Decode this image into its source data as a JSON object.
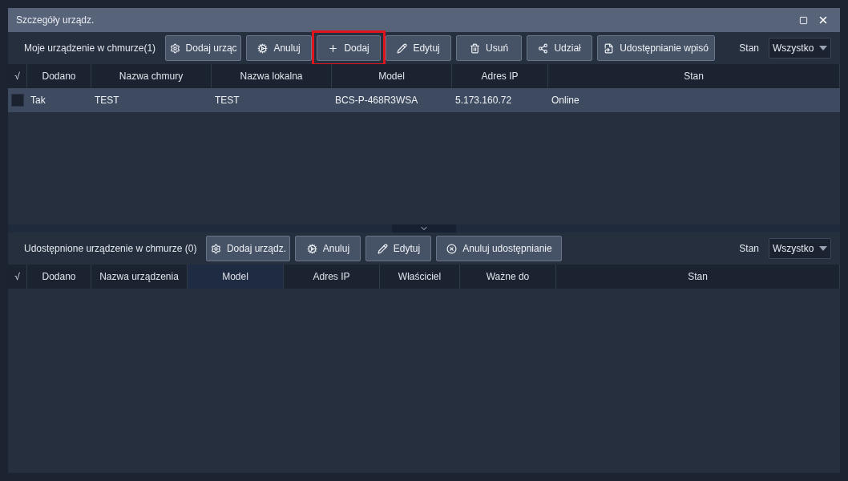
{
  "window": {
    "title": "Szczegóły urządz."
  },
  "my_devices": {
    "label": "Moje urządzenie w chmurze(1)",
    "buttons": [
      {
        "kind": "add-device",
        "label": "Dodaj urząc",
        "highlighted": false
      },
      {
        "kind": "cancel",
        "label": "Anuluj",
        "highlighted": false
      },
      {
        "kind": "add",
        "label": "Dodaj",
        "highlighted": true
      },
      {
        "kind": "edit",
        "label": "Edytuj",
        "highlighted": false
      },
      {
        "kind": "delete",
        "label": "Usuń",
        "highlighted": false
      },
      {
        "kind": "share",
        "label": "Udział",
        "highlighted": false
      },
      {
        "kind": "share-entry",
        "label": "Udostępnianie wpisó",
        "highlighted": false
      }
    ],
    "filter": {
      "label": "Stan",
      "value": "Wszystko"
    },
    "table": {
      "columns": [
        {
          "label": "√",
          "highlighted": false
        },
        {
          "label": "Dodano",
          "highlighted": false
        },
        {
          "label": "Nazwa chmury",
          "highlighted": false
        },
        {
          "label": "Nazwa lokalna",
          "highlighted": false
        },
        {
          "label": "Model",
          "highlighted": false
        },
        {
          "label": "Adres IP",
          "highlighted": false
        },
        {
          "label": "Stan",
          "highlighted": false
        }
      ],
      "rows": [
        {
          "checked": false,
          "selected": true,
          "cells": [
            "",
            "Tak",
            "TEST",
            "TEST",
            "BCS-P-468R3WSA",
            "5.173.160.72",
            "Online"
          ]
        }
      ]
    }
  },
  "shared_devices": {
    "label": "Udostępnione urządzenie w chmurze (0)",
    "buttons": [
      {
        "kind": "add-device",
        "label": "Dodaj urządz.",
        "highlighted": false
      },
      {
        "kind": "cancel",
        "label": "Anuluj",
        "highlighted": false
      },
      {
        "kind": "edit",
        "label": "Edytuj",
        "highlighted": false
      },
      {
        "kind": "cancel-share",
        "label": "Anuluj udostępnianie",
        "highlighted": false
      }
    ],
    "filter": {
      "label": "Stan",
      "value": "Wszystko"
    },
    "table": {
      "columns": [
        {
          "label": "√",
          "highlighted": false
        },
        {
          "label": "Dodano",
          "highlighted": false
        },
        {
          "label": "Nazwa urządzenia",
          "highlighted": false
        },
        {
          "label": "Model",
          "highlighted": true
        },
        {
          "label": "Adres IP",
          "highlighted": false
        },
        {
          "label": "Właściciel",
          "highlighted": false
        },
        {
          "label": "Ważne do",
          "highlighted": false
        },
        {
          "label": "Stan",
          "highlighted": false
        }
      ]
    }
  }
}
